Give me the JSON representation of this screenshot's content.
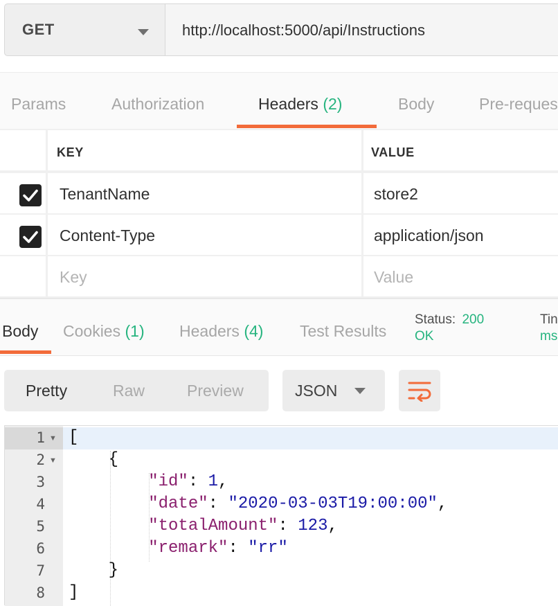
{
  "request": {
    "method": "GET",
    "url": "http://localhost:5000/api/Instructions"
  },
  "request_tabs": [
    {
      "label": "Params",
      "count": ""
    },
    {
      "label": "Authorization",
      "count": ""
    },
    {
      "label": "Headers",
      "count": "(2)"
    },
    {
      "label": "Body",
      "count": ""
    },
    {
      "label": "Pre-reques",
      "count": ""
    }
  ],
  "headers_table": {
    "columns": [
      "KEY",
      "VALUE"
    ],
    "rows": [
      {
        "checked": true,
        "key": "TenantName",
        "value": "store2"
      },
      {
        "checked": true,
        "key": "Content-Type",
        "value": "application/json"
      }
    ],
    "placeholder": {
      "key": "Key",
      "value": "Value"
    }
  },
  "response_tabs": [
    {
      "label": "Body",
      "count": ""
    },
    {
      "label": "Cookies",
      "count": "(1)"
    },
    {
      "label": "Headers",
      "count": "(4)"
    },
    {
      "label": "Test Results",
      "count": ""
    }
  ],
  "response_meta": {
    "status_label": "Status:",
    "status_code": "200",
    "status_text": "OK",
    "time_label": "Tin",
    "time_value": "ms"
  },
  "view_modes": [
    "Pretty",
    "Raw",
    "Preview"
  ],
  "format": {
    "selected": "JSON"
  },
  "code": {
    "line_numbers": [
      "1",
      "2",
      "3",
      "4",
      "5",
      "6",
      "7",
      "8"
    ],
    "lines": [
      {
        "indent": "",
        "parts": [
          {
            "t": "p",
            "v": "["
          }
        ]
      },
      {
        "indent": "    ",
        "parts": [
          {
            "t": "p",
            "v": "{"
          }
        ]
      },
      {
        "indent": "        ",
        "parts": [
          {
            "t": "k",
            "v": "\"id\""
          },
          {
            "t": "p",
            "v": ": "
          },
          {
            "t": "n",
            "v": "1"
          },
          {
            "t": "p",
            "v": ","
          }
        ]
      },
      {
        "indent": "        ",
        "parts": [
          {
            "t": "k",
            "v": "\"date\""
          },
          {
            "t": "p",
            "v": ": "
          },
          {
            "t": "s",
            "v": "\"2020-03-03T19:00:00\""
          },
          {
            "t": "p",
            "v": ","
          }
        ]
      },
      {
        "indent": "        ",
        "parts": [
          {
            "t": "k",
            "v": "\"totalAmount\""
          },
          {
            "t": "p",
            "v": ": "
          },
          {
            "t": "n",
            "v": "123"
          },
          {
            "t": "p",
            "v": ","
          }
        ]
      },
      {
        "indent": "        ",
        "parts": [
          {
            "t": "k",
            "v": "\"remark\""
          },
          {
            "t": "p",
            "v": ": "
          },
          {
            "t": "s",
            "v": "\"rr\""
          }
        ]
      },
      {
        "indent": "    ",
        "parts": [
          {
            "t": "p",
            "v": "}"
          }
        ]
      },
      {
        "indent": "",
        "parts": [
          {
            "t": "p",
            "v": "]"
          }
        ]
      }
    ]
  },
  "colors": {
    "accent": "#f26b3a",
    "count_green": "#26b47f",
    "json_key": "#8a1f6d",
    "json_value": "#1a1aa6"
  },
  "icons": {
    "method_dropdown": "chevron-down-icon",
    "checkbox": "check-icon",
    "wrap": "wrap-lines-icon",
    "fold": "fold-arrow-icon"
  }
}
